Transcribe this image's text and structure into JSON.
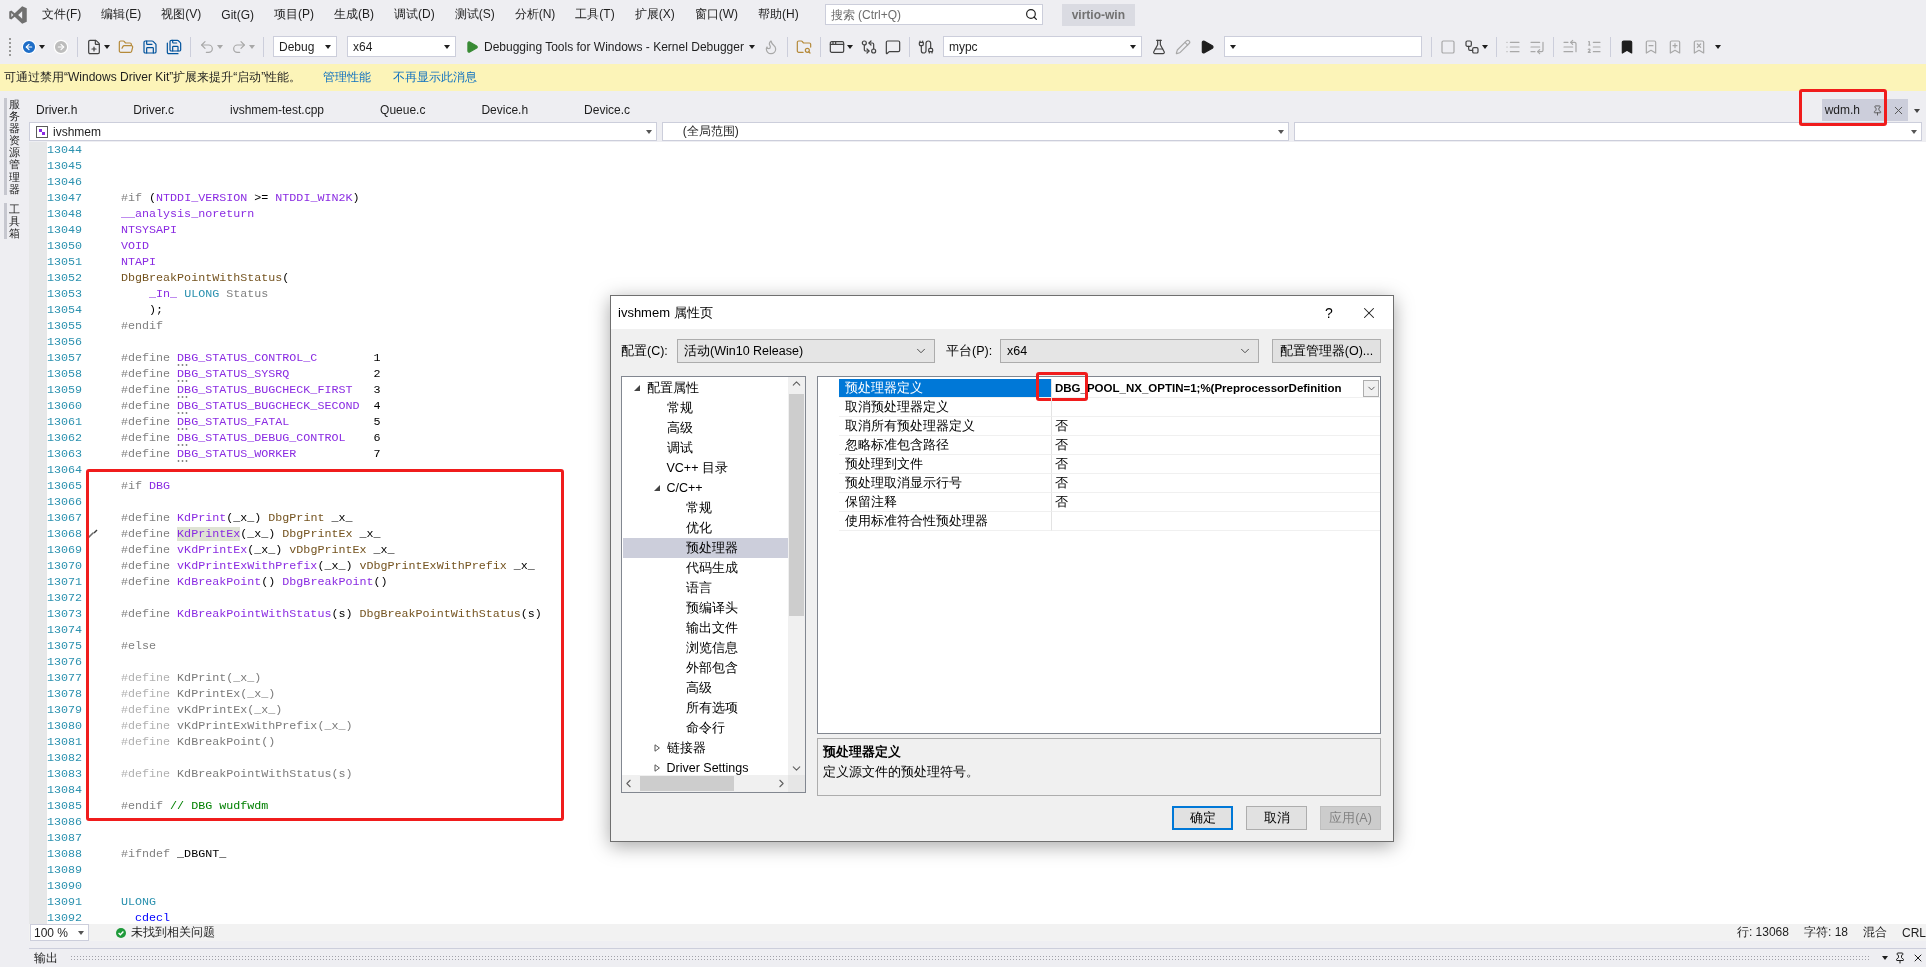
{
  "menu_bar": {
    "items": [
      "文件(F)",
      "编辑(E)",
      "视图(V)",
      "Git(G)",
      "项目(P)",
      "生成(B)",
      "调试(D)",
      "测试(S)",
      "分析(N)",
      "工具(T)",
      "扩展(X)",
      "窗口(W)",
      "帮助(H)"
    ],
    "search": {
      "placeholder": "搜索 (Ctrl+Q)"
    },
    "solution": "virtio-win"
  },
  "toolbar": {
    "groups": [
      [
        {
          "kind": "button",
          "disabled": false,
          "menu": true
        },
        {
          "kind": "button",
          "disabled": true,
          "menu": false
        }
      ],
      [
        {
          "kind": "button",
          "disabled": false,
          "menu": true
        },
        {
          "kind": "button",
          "disabled": false,
          "menu": false
        },
        {
          "kind": "button",
          "disabled": false,
          "menu": false
        },
        {
          "kind": "button",
          "disabled": false,
          "menu": false
        }
      ],
      [
        {
          "kind": "button",
          "disabled": true,
          "menu": true
        },
        {
          "kind": "button",
          "disabled": true,
          "menu": true
        }
      ],
      [
        {
          "kind": "combo",
          "value": "Debug"
        },
        {
          "kind": "combo",
          "value": "x64"
        },
        {
          "kind": "launch",
          "label": "Debugging Tools for Windows - Kernel Debugger"
        },
        {
          "kind": "button",
          "disabled": true,
          "menu": false
        }
      ],
      [
        {
          "kind": "button",
          "disabled": false,
          "menu": false
        }
      ],
      [
        {
          "kind": "button",
          "disabled": false,
          "menu": true
        },
        {
          "kind": "button",
          "disabled": false,
          "menu": false
        },
        {
          "kind": "button",
          "disabled": false,
          "menu": false
        }
      ],
      [
        {
          "kind": "button",
          "disabled": false,
          "menu": false
        },
        {
          "kind": "combo",
          "value": "mypc"
        },
        {
          "kind": "button",
          "disabled": false,
          "menu": false
        },
        {
          "kind": "button",
          "disabled": true,
          "menu": false
        },
        {
          "kind": "button",
          "disabled": false,
          "menu": false
        },
        {
          "kind": "combo"
        }
      ],
      [
        {
          "kind": "button",
          "disabled": true,
          "menu": false
        },
        {
          "kind": "button",
          "disabled": false,
          "menu": true
        }
      ],
      [
        {
          "kind": "button",
          "disabled": true,
          "menu": false
        },
        {
          "kind": "button",
          "disabled": true,
          "menu": false
        }
      ],
      [
        {
          "kind": "button",
          "disabled": true,
          "menu": false
        },
        {
          "kind": "button",
          "disabled": true,
          "menu": false
        }
      ],
      [
        {
          "kind": "button",
          "disabled": false,
          "menu": false
        },
        {
          "kind": "button",
          "disabled": true,
          "menu": false
        },
        {
          "kind": "button",
          "disabled": true,
          "menu": false
        },
        {
          "kind": "button",
          "disabled": true,
          "menu": false
        }
      ]
    ]
  },
  "info_bar": {
    "message": "可通过禁用“Windows Driver Kit”扩展来提升“启动”性能。",
    "links": [
      "管理性能",
      "不再显示此消息"
    ]
  },
  "side_rail": {
    "tabs": [
      "服务器资源管理器",
      "工具箱"
    ]
  },
  "document_tabs": [
    {
      "label": "Driver.h",
      "selected": false,
      "preview": false,
      "outlined": false
    },
    {
      "label": "Driver.c",
      "selected": false,
      "preview": false,
      "outlined": false
    },
    {
      "label": "ivshmem-test.cpp",
      "selected": false,
      "preview": false,
      "outlined": false
    },
    {
      "label": "Queue.c",
      "selected": false,
      "preview": false,
      "outlined": false
    },
    {
      "label": "Device.h",
      "selected": false,
      "preview": false,
      "outlined": false
    },
    {
      "label": "Device.c",
      "selected": false,
      "preview": false,
      "outlined": false
    },
    {
      "label": "wdm.h",
      "selected": true,
      "preview": true,
      "outlined": true
    }
  ],
  "navigation_bar": {
    "project": "ivshmem",
    "scope": "(全局范围)"
  },
  "editor": {
    "blocks": [
      {
        "outlined": false,
        "lines": [
          {
            "number": "13044",
            "glyph": false
          },
          {
            "number": "13045",
            "glyph": false
          },
          {
            "number": "13046",
            "glyph": false
          },
          {
            "number": "13047",
            "glyph": false,
            "tokens": [
              {
                "kind": "directive",
                "text": "#if "
              },
              {
                "kind": "text",
                "text": "("
              },
              {
                "kind": "macro",
                "text": "NTDDI_VERSION"
              },
              {
                "kind": "text",
                "text": " >= "
              },
              {
                "kind": "macro",
                "text": "NTDDI_WIN2K"
              },
              {
                "kind": "text",
                "text": ")"
              }
            ]
          },
          {
            "number": "13048",
            "glyph": false,
            "tokens": [
              {
                "kind": "macro",
                "text": "__analysis_noreturn"
              }
            ]
          },
          {
            "number": "13049",
            "glyph": false,
            "tokens": [
              {
                "kind": "macro",
                "text": "NTSYSAPI"
              }
            ]
          },
          {
            "number": "13050",
            "glyph": false,
            "tokens": [
              {
                "kind": "macro",
                "text": "VOID"
              }
            ]
          },
          {
            "number": "13051",
            "glyph": false,
            "tokens": [
              {
                "kind": "macro",
                "text": "NTAPI"
              }
            ]
          },
          {
            "number": "13052",
            "glyph": false,
            "tokens": [
              {
                "kind": "function",
                "text": "DbgBreakPointWithStatus"
              },
              {
                "kind": "text",
                "text": "("
              }
            ]
          },
          {
            "number": "13053",
            "glyph": false,
            "tokens": [
              {
                "kind": "macro",
                "text": "    _In_ "
              },
              {
                "kind": "type",
                "text": "ULONG "
              },
              {
                "kind": "param",
                "text": "Status"
              }
            ]
          },
          {
            "number": "13054",
            "glyph": false,
            "tokens": [
              {
                "kind": "text",
                "text": "    );"
              }
            ]
          },
          {
            "number": "13055",
            "glyph": false,
            "tokens": [
              {
                "kind": "directive",
                "text": "#endif"
              }
            ]
          },
          {
            "number": "13056",
            "glyph": false
          },
          {
            "number": "13057",
            "glyph": false,
            "tokens": [
              {
                "kind": "directive",
                "text": "#define "
              },
              {
                "kind": "hinted",
                "text": "DBG_STATUS_CONTROL_C"
              },
              {
                "kind": "text",
                "text": "        1"
              }
            ]
          },
          {
            "number": "13058",
            "glyph": false,
            "tokens": [
              {
                "kind": "directive",
                "text": "#define "
              },
              {
                "kind": "hinted",
                "text": "DBG_STATUS_SYSRQ"
              },
              {
                "kind": "text",
                "text": "            2"
              }
            ]
          },
          {
            "number": "13059",
            "glyph": false,
            "tokens": [
              {
                "kind": "directive",
                "text": "#define "
              },
              {
                "kind": "hinted",
                "text": "DBG_STATUS_BUGCHECK_FIRST"
              },
              {
                "kind": "text",
                "text": "   3"
              }
            ]
          },
          {
            "number": "13060",
            "glyph": false,
            "tokens": [
              {
                "kind": "directive",
                "text": "#define "
              },
              {
                "kind": "hinted",
                "text": "DBG_STATUS_BUGCHECK_SECOND"
              },
              {
                "kind": "text",
                "text": "  4"
              }
            ]
          },
          {
            "number": "13061",
            "glyph": false,
            "tokens": [
              {
                "kind": "directive",
                "text": "#define "
              },
              {
                "kind": "hinted",
                "text": "DBG_STATUS_FATAL"
              },
              {
                "kind": "text",
                "text": "            5"
              }
            ]
          },
          {
            "number": "13062",
            "glyph": false,
            "tokens": [
              {
                "kind": "directive",
                "text": "#define "
              },
              {
                "kind": "hinted",
                "text": "DBG_STATUS_DEBUG_CONTROL"
              },
              {
                "kind": "text",
                "text": "    6"
              }
            ]
          },
          {
            "number": "13063",
            "glyph": false,
            "tokens": [
              {
                "kind": "directive",
                "text": "#define "
              },
              {
                "kind": "hinted",
                "text": "DBG_STATUS_WORKER"
              },
              {
                "kind": "text",
                "text": "           7"
              }
            ]
          },
          {
            "number": "13064",
            "glyph": false
          }
        ]
      },
      {
        "outlined": true,
        "lines": [
          {
            "number": "13065",
            "glyph": false,
            "tokens": [
              {
                "kind": "directive",
                "text": "#if "
              },
              {
                "kind": "macro",
                "text": "DBG"
              }
            ]
          },
          {
            "number": "13066",
            "glyph": false
          },
          {
            "number": "13067",
            "glyph": false,
            "tokens": [
              {
                "kind": "directive",
                "text": "#define "
              },
              {
                "kind": "macro",
                "text": "KdPrint"
              },
              {
                "kind": "text",
                "text": "(_x_) "
              },
              {
                "kind": "function",
                "text": "DbgPrint"
              },
              {
                "kind": "text",
                "text": " _x_"
              }
            ]
          },
          {
            "number": "13068",
            "glyph": true,
            "tokens": [
              {
                "kind": "directive",
                "text": "#define "
              },
              {
                "kind": "reference",
                "text": "KdPrintEx"
              },
              {
                "kind": "text",
                "text": "(_x_) "
              },
              {
                "kind": "function",
                "text": "DbgPrintEx"
              },
              {
                "kind": "text",
                "text": " _x_"
              }
            ]
          },
          {
            "number": "13069",
            "glyph": false,
            "tokens": [
              {
                "kind": "directive",
                "text": "#define "
              },
              {
                "kind": "macro",
                "text": "vKdPrintEx"
              },
              {
                "kind": "text",
                "text": "(_x_) "
              },
              {
                "kind": "function",
                "text": "vDbgPrintEx"
              },
              {
                "kind": "text",
                "text": " _x_"
              }
            ]
          },
          {
            "number": "13070",
            "glyph": false,
            "tokens": [
              {
                "kind": "directive",
                "text": "#define "
              },
              {
                "kind": "macro",
                "text": "vKdPrintExWithPrefix"
              },
              {
                "kind": "text",
                "text": "(_x_) "
              },
              {
                "kind": "function",
                "text": "vDbgPrintExWithPrefix"
              },
              {
                "kind": "text",
                "text": " _x_"
              }
            ]
          },
          {
            "number": "13071",
            "glyph": false,
            "tokens": [
              {
                "kind": "directive",
                "text": "#define "
              },
              {
                "kind": "macro",
                "text": "KdBreakPoint"
              },
              {
                "kind": "text",
                "text": "() "
              },
              {
                "kind": "macro",
                "text": "DbgBreakPoint"
              },
              {
                "kind": "text",
                "text": "()"
              }
            ]
          },
          {
            "number": "13072",
            "glyph": false
          },
          {
            "number": "13073",
            "glyph": false,
            "tokens": [
              {
                "kind": "directive",
                "text": "#define "
              },
              {
                "kind": "macro",
                "text": "KdBreakPointWithStatus"
              },
              {
                "kind": "text",
                "text": "(s) "
              },
              {
                "kind": "function",
                "text": "DbgBreakPointWithStatus"
              },
              {
                "kind": "text",
                "text": "(s)"
              }
            ]
          },
          {
            "number": "13074",
            "glyph": false
          },
          {
            "number": "13075",
            "glyph": false,
            "tokens": [
              {
                "kind": "directive",
                "text": "#else"
              }
            ]
          },
          {
            "number": "13076",
            "glyph": false
          },
          {
            "number": "13077",
            "glyph": false,
            "tokens": [
              {
                "kind": "faded",
                "text": "#define "
              },
              {
                "kind": "inactive",
                "text": "KdPrint(_x_)"
              }
            ]
          },
          {
            "number": "13078",
            "glyph": false,
            "tokens": [
              {
                "kind": "faded",
                "text": "#define "
              },
              {
                "kind": "inactive",
                "text": "KdPrintEx(_x_)"
              }
            ]
          },
          {
            "number": "13079",
            "glyph": false,
            "tokens": [
              {
                "kind": "faded",
                "text": "#define "
              },
              {
                "kind": "inactive",
                "text": "vKdPrintEx(_x_)"
              }
            ]
          },
          {
            "number": "13080",
            "glyph": false,
            "tokens": [
              {
                "kind": "faded",
                "text": "#define "
              },
              {
                "kind": "inactive",
                "text": "vKdPrintExWithPrefix(_x_)"
              }
            ]
          },
          {
            "number": "13081",
            "glyph": false,
            "tokens": [
              {
                "kind": "faded",
                "text": "#define "
              },
              {
                "kind": "inactive",
                "text": "KdBreakPoint()"
              }
            ]
          },
          {
            "number": "13082",
            "glyph": false
          },
          {
            "number": "13083",
            "glyph": false,
            "tokens": [
              {
                "kind": "faded",
                "text": "#define "
              },
              {
                "kind": "inactive",
                "text": "KdBreakPointWithStatus(s)"
              }
            ]
          },
          {
            "number": "13084",
            "glyph": false
          },
          {
            "number": "13085",
            "glyph": false,
            "tokens": [
              {
                "kind": "directive",
                "text": "#endif "
              },
              {
                "kind": "comment",
                "text": "// DBG wudfwdm"
              }
            ]
          }
        ]
      },
      {
        "outlined": false,
        "lines": [
          {
            "number": "13086",
            "glyph": false
          },
          {
            "number": "13087",
            "glyph": false
          },
          {
            "number": "13088",
            "glyph": false,
            "tokens": [
              {
                "kind": "directive",
                "text": "#ifndef "
              },
              {
                "kind": "text",
                "text": "_DBGNT_"
              }
            ]
          },
          {
            "number": "13089",
            "glyph": false
          },
          {
            "number": "13090",
            "glyph": false
          },
          {
            "number": "13091",
            "glyph": false,
            "tokens": [
              {
                "kind": "type",
                "text": "ULONG"
              }
            ]
          },
          {
            "number": "13092",
            "glyph": false,
            "tokens": [
              {
                "kind": "keyword",
                "text": "  cdecl"
              }
            ]
          }
        ]
      }
    ]
  },
  "editor_status": {
    "zoom": "100 %",
    "issues": "未找到相关问题",
    "line": "行: 13068",
    "character": "字符: 18",
    "indentation": "混合",
    "line_endings": "CRL"
  },
  "output_panel": {
    "title": "输出"
  },
  "dialog": {
    "title": "ivshmem 属性页",
    "help": "?",
    "configuration": {
      "label": "配置(C):",
      "value": "活动(Win10 Release)"
    },
    "platform": {
      "label": "平台(P):",
      "value": "x64"
    },
    "manager_button": "配置管理器(O)...",
    "tree": [
      {
        "label": "配置属性",
        "selected": false,
        "expanded": true,
        "children": [
          {
            "label": "常规",
            "selected": false
          },
          {
            "label": "高级",
            "selected": false
          },
          {
            "label": "调试",
            "selected": false
          },
          {
            "label": "VC++ 目录",
            "selected": false
          },
          {
            "label": "C/C++",
            "selected": false,
            "expanded": true,
            "children": [
              {
                "label": "常规",
                "selected": false
              },
              {
                "label": "优化",
                "selected": false
              },
              {
                "label": "预处理器",
                "selected": true
              },
              {
                "label": "代码生成",
                "selected": false
              },
              {
                "label": "语言",
                "selected": false
              },
              {
                "label": "预编译头",
                "selected": false
              },
              {
                "label": "输出文件",
                "selected": false
              },
              {
                "label": "浏览信息",
                "selected": false
              },
              {
                "label": "外部包含",
                "selected": false
              },
              {
                "label": "高级",
                "selected": false
              },
              {
                "label": "所有选项",
                "selected": false
              },
              {
                "label": "命令行",
                "selected": false
              }
            ]
          },
          {
            "label": "链接器",
            "selected": false,
            "expanded": false
          },
          {
            "label": "Driver Settings",
            "selected": false,
            "expanded": false
          }
        ]
      }
    ],
    "properties": [
      {
        "name": "预处理器定义",
        "value": "DBG_POOL_NX_OPTIN=1;%(PreprocessorDefinition",
        "selected": true,
        "modified": true,
        "outlined": true
      },
      {
        "name": "取消预处理器定义",
        "selected": false,
        "modified": false,
        "outlined": false
      },
      {
        "name": "取消所有预处理器定义",
        "value": "否",
        "selected": false,
        "modified": false,
        "outlined": false
      },
      {
        "name": "忽略标准包含路径",
        "value": "否",
        "selected": false,
        "modified": false,
        "outlined": false
      },
      {
        "name": "预处理到文件",
        "value": "否",
        "selected": false,
        "modified": false,
        "outlined": false
      },
      {
        "name": "预处理取消显示行号",
        "value": "否",
        "selected": false,
        "modified": false,
        "outlined": false
      },
      {
        "name": "保留注释",
        "value": "否",
        "selected": false,
        "modified": false,
        "outlined": false
      },
      {
        "name": "使用标准符合性预处理器",
        "selected": false,
        "modified": false,
        "outlined": false
      }
    ],
    "description": {
      "title": "预处理器定义",
      "text": "定义源文件的预处理符号。"
    },
    "buttons": [
      {
        "label": "确定",
        "default": true,
        "disabled": false
      },
      {
        "label": "取消",
        "default": false,
        "disabled": false
      },
      {
        "label": "应用(A)",
        "default": false,
        "disabled": true
      }
    ]
  }
}
